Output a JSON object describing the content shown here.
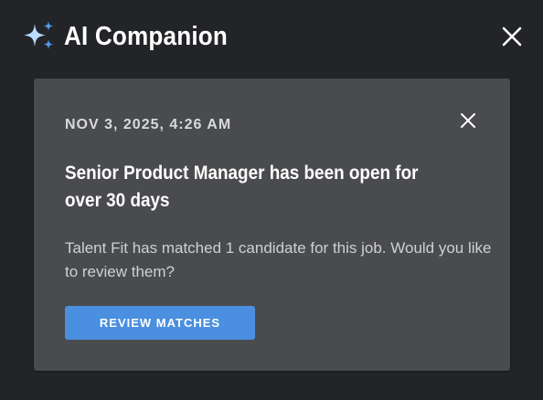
{
  "header": {
    "title": "AI Companion",
    "icon": "sparkle-icon",
    "close_icon": "close-icon"
  },
  "notification": {
    "timestamp": "NOV 3, 2025, 4:26 AM",
    "headline": "Senior Product Manager has been open for over 30 days",
    "message": "Talent Fit has matched 1 candidate for this job. Would you like to review them?",
    "cta_label": "REVIEW MATCHES",
    "dismiss_icon": "close-icon"
  },
  "colors": {
    "background": "#232427",
    "card": "#4a4b4e",
    "accent": "#4a8fe0",
    "sparkle_light": "#bfe0ff",
    "sparkle_dark": "#4f9bea"
  }
}
